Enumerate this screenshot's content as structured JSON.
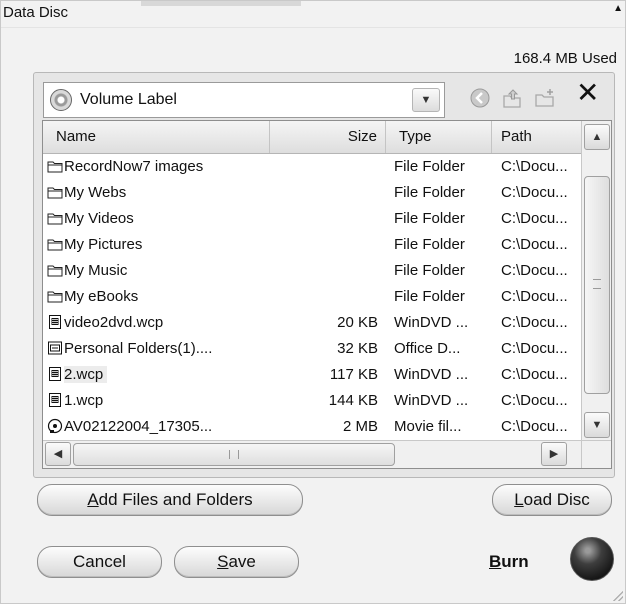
{
  "window": {
    "title": "Data Disc"
  },
  "used_size": "168.4 MB Used",
  "volume": {
    "label": "Volume Label"
  },
  "columns": {
    "name": "Name",
    "size": "Size",
    "type": "Type",
    "path": "Path"
  },
  "files": [
    {
      "name": "RecordNow7 images",
      "size": "",
      "type": "File Folder",
      "path": "C:\\Docu...",
      "icon": "folder-icon"
    },
    {
      "name": "My Webs",
      "size": "",
      "type": "File Folder",
      "path": "C:\\Docu...",
      "icon": "folder-icon"
    },
    {
      "name": "My Videos",
      "size": "",
      "type": "File Folder",
      "path": "C:\\Docu...",
      "icon": "folder-icon"
    },
    {
      "name": "My Pictures",
      "size": "",
      "type": "File Folder",
      "path": "C:\\Docu...",
      "icon": "folder-icon"
    },
    {
      "name": "My Music",
      "size": "",
      "type": "File Folder",
      "path": "C:\\Docu...",
      "icon": "folder-icon"
    },
    {
      "name": "My eBooks",
      "size": "",
      "type": "File Folder",
      "path": "C:\\Docu...",
      "icon": "folder-icon"
    },
    {
      "name": "video2dvd.wcp",
      "size": "20 KB",
      "type": "WinDVD ...",
      "path": "C:\\Docu...",
      "icon": "wcp-file-icon"
    },
    {
      "name": "Personal Folders(1)....",
      "size": "32 KB",
      "type": "Office D...",
      "path": "C:\\Docu...",
      "icon": "office-file-icon"
    },
    {
      "name": "2.wcp",
      "size": "117 KB",
      "type": "WinDVD ...",
      "path": "C:\\Docu...",
      "icon": "wcp-file-icon",
      "selected": true
    },
    {
      "name": "1.wcp",
      "size": "144 KB",
      "type": "WinDVD ...",
      "path": "C:\\Docu...",
      "icon": "wcp-file-icon"
    },
    {
      "name": "AV02122004_17305...",
      "size": "2 MB",
      "type": "Movie fil...",
      "path": "C:\\Docu...",
      "icon": "movie-file-icon"
    }
  ],
  "buttons": {
    "add": {
      "pre": "",
      "key": "A",
      "post": "dd Files and Folders"
    },
    "load": {
      "pre": "",
      "key": "L",
      "post": "oad Disc"
    },
    "cancel": {
      "pre": "Cancel",
      "key": "",
      "post": ""
    },
    "save": {
      "pre": "",
      "key": "S",
      "post": "ave"
    },
    "burn": {
      "pre": "",
      "key": "B",
      "post": "urn"
    }
  }
}
